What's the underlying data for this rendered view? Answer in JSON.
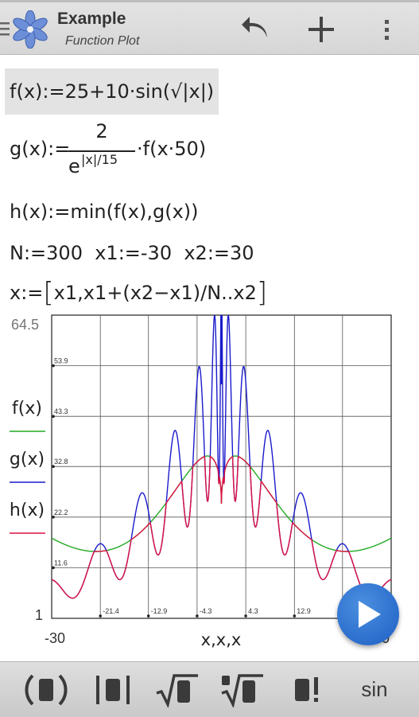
{
  "app": {
    "title": "Example",
    "subtitle": "Function Plot",
    "icons": {
      "menu": "menu-icon",
      "app": "flower-app-icon",
      "undo": "undo-icon",
      "add": "plus-icon",
      "overflow": "overflow-icon"
    }
  },
  "worksheet": {
    "f_def": {
      "lhs": "f(x):=",
      "expr": "25+10·sin(√|x|)"
    },
    "g_def": {
      "lhs": "g(x):=",
      "num": "2",
      "den_base": "e",
      "den_exp": "|x|/15",
      "tail": "·f(x·50)"
    },
    "h_def": {
      "lhs": "h(x):=",
      "expr": "min(f(x),g(x))"
    },
    "params": "N:=300  x1:=-30  x2:=30",
    "range": {
      "lhs": "x:=",
      "expr": "x1,x1+(x2−x1)/N..x2"
    }
  },
  "plot": {
    "ymax_label": "64.5",
    "ymin_label": "1",
    "xmin_label": "-30",
    "xmax_label": "30",
    "xlabel": "x,x,x",
    "legend": [
      {
        "name": "f(x)",
        "color": "#22aa22"
      },
      {
        "name": "g(x)",
        "color": "#1a1acc"
      },
      {
        "name": "h(x)",
        "color": "#dd1144"
      }
    ],
    "gridline_color": "#555555"
  },
  "chart_data": {
    "type": "line",
    "xlim": [
      -30,
      30
    ],
    "ylim": [
      1,
      64.5
    ],
    "x_ticks": [
      "-21.4",
      "-12.9",
      "-4.3",
      "4.3",
      "12.9",
      "21.4"
    ],
    "y_ticks": [
      "11.6",
      "22.2",
      "32.8",
      "43.3",
      "53.9"
    ],
    "x_range": {
      "start": -30,
      "end": 30,
      "points": 300
    },
    "xlabel": "x,x,x",
    "grid": true,
    "legend_position": "left",
    "series": [
      {
        "name": "f(x)",
        "formula": "25+10·sin(√|x|)"
      },
      {
        "name": "g(x)",
        "formula": "2/e^(|x|/15)·f(x·50)"
      },
      {
        "name": "h(x)",
        "formula": "min(f(x),g(x))"
      }
    ]
  },
  "bottom_bar": {
    "buttons": [
      {
        "name": "parentheses-button",
        "icon": "parentheses-icon"
      },
      {
        "name": "abs-button",
        "icon": "abs-icon"
      },
      {
        "name": "sqrt-button",
        "icon": "sqrt-icon"
      },
      {
        "name": "nth-root-button",
        "icon": "nth-root-icon"
      },
      {
        "name": "factorial-button",
        "icon": "factorial-icon"
      },
      {
        "name": "sin-button",
        "label": "sin"
      }
    ]
  },
  "fab": {
    "icon": "play-icon"
  }
}
